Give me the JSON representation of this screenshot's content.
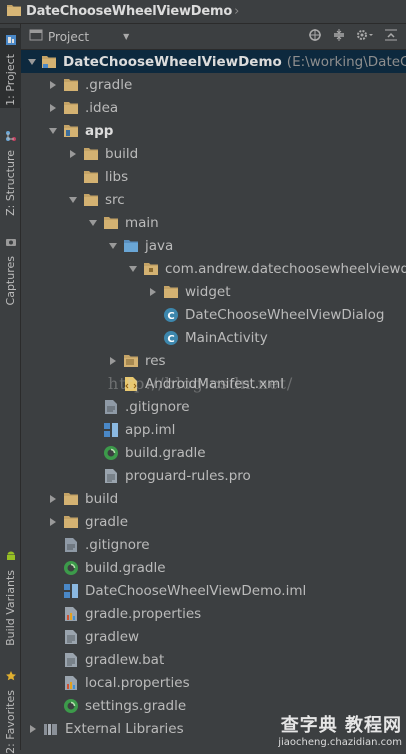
{
  "window": {
    "title": "DateChooseWheelViewDemo"
  },
  "side_tabs": [
    {
      "label": "1: Project",
      "icon": "project-icon"
    },
    {
      "label": "Z: Structure",
      "icon": "structure-icon"
    },
    {
      "label": "Captures",
      "icon": "captures-icon"
    },
    {
      "label": "Build Variants",
      "icon": "android-icon"
    },
    {
      "label": "2: Favorites",
      "icon": "star-icon"
    }
  ],
  "toolbar": {
    "view_label": "Project"
  },
  "tree": [
    {
      "label": "DateChooseWheelViewDemo",
      "sub": "(E:\\working\\DateChooseWheelViewDemo)",
      "bold": true
    },
    {
      "label": ".gradle"
    },
    {
      "label": ".idea"
    },
    {
      "label": "app",
      "bold": true
    },
    {
      "label": "build"
    },
    {
      "label": "libs"
    },
    {
      "label": "src"
    },
    {
      "label": "main"
    },
    {
      "label": "java"
    },
    {
      "label": "com.andrew.datechoosewheelviewdemo"
    },
    {
      "label": "widget"
    },
    {
      "label": "DateChooseWheelViewDialog"
    },
    {
      "label": "MainActivity"
    },
    {
      "label": "res"
    },
    {
      "label": "AndroidManifest.xml"
    },
    {
      "label": ".gitignore"
    },
    {
      "label": "app.iml"
    },
    {
      "label": "build.gradle"
    },
    {
      "label": "proguard-rules.pro"
    },
    {
      "label": "build"
    },
    {
      "label": "gradle"
    },
    {
      "label": ".gitignore"
    },
    {
      "label": "build.gradle"
    },
    {
      "label": "DateChooseWheelViewDemo.iml"
    },
    {
      "label": "gradle.properties"
    },
    {
      "label": "gradlew"
    },
    {
      "label": "gradlew.bat"
    },
    {
      "label": "local.properties"
    },
    {
      "label": "settings.gradle"
    },
    {
      "label": "External Libraries"
    }
  ],
  "watermark": "http://blog.csdn.net/",
  "site_logo": {
    "name": "查字典 教程网",
    "url": "jiaocheng.chazidian.com"
  },
  "colors": {
    "background": "#3c3f41",
    "selection": "#0d293e",
    "folder": "#c4a366",
    "source_folder": "#6aa6d6",
    "text": "#bbbbbb"
  }
}
